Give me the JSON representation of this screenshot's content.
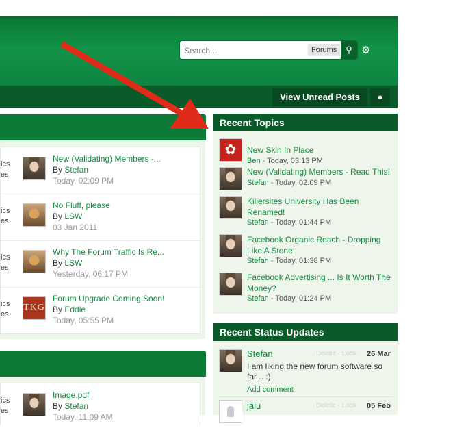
{
  "header": {
    "search_placeholder": "Search...",
    "search_scope": "Forums",
    "search_button_icon": "search-icon",
    "settings_icon": "gear-icon"
  },
  "nav": {
    "view_unread": "View Unread Posts",
    "pin_icon": "map-pin-icon"
  },
  "left_section_1": {
    "rows": [
      {
        "cut_a": "ics",
        "cut_b": "es",
        "title": "New (Validating) Members -...",
        "by": "By",
        "author": "Stefan",
        "date": "Today, 02:09 PM",
        "avatar": "stefan"
      },
      {
        "cut_a": "ics",
        "cut_b": "es",
        "title": "No Fluff, please",
        "by": "By",
        "author": "LSW",
        "date": "03 Jan 2011",
        "avatar": "monk"
      },
      {
        "cut_a": "ics",
        "cut_b": "es",
        "title": "Why The Forum Traffic Is Re...",
        "by": "By",
        "author": "LSW",
        "date": "Yesterday, 06:17 PM",
        "avatar": "monk"
      },
      {
        "cut_a": "ics",
        "cut_b": "es",
        "title": "Forum Upgrade Coming Soon!",
        "by": "By",
        "author": "Eddie",
        "date": "Today, 05:55 PM",
        "avatar": "tkg",
        "avatar_text": "TKG"
      }
    ]
  },
  "left_section_2": {
    "rows": [
      {
        "cut_a": "ics",
        "cut_b": "es",
        "title": "Image.pdf",
        "by": "By",
        "author": "Stefan",
        "date": "Today, 11:09 AM",
        "avatar": "stefan"
      }
    ]
  },
  "recent_topics": {
    "heading": "Recent Topics",
    "items": [
      {
        "title": "New Skin In Place",
        "author": "Ben",
        "time": " - Today, 03:13 PM",
        "avatar": "red-logo"
      },
      {
        "title": "New (Validating) Members - Read This!",
        "author": "Stefan",
        "time": " - Today, 02:09 PM",
        "avatar": "stefan"
      },
      {
        "title": "Killersites University Has Been Renamed!",
        "author": "Stefan",
        "time": " - Today, 01:44 PM",
        "avatar": "stefan"
      },
      {
        "title": "Facebook Organic Reach - Dropping Like A Stone!",
        "author": "Stefan",
        "time": " - Today, 01:38 PM",
        "avatar": "stefan"
      },
      {
        "title": "Facebook Advertising ... Is It Worth The Money?",
        "author": "Stefan",
        "time": " - Today, 01:24 PM",
        "avatar": "stefan"
      }
    ]
  },
  "status_updates": {
    "heading": "Recent Status Updates",
    "items": [
      {
        "name": "Stefan",
        "controls": "Delete · Lock",
        "date": "26 Mar",
        "text": "I am liking the new forum software so far .. :)",
        "add_comment": "Add comment"
      },
      {
        "name": "jalu",
        "controls": "Delete · Lock",
        "date": "05 Feb"
      }
    ]
  },
  "colors": {
    "header_green": "#129347",
    "dark_green": "#0b5a2a",
    "link_green": "#138a3f",
    "panel_bg": "#eef6ec",
    "annotation_arrow": "#e02a1a"
  }
}
